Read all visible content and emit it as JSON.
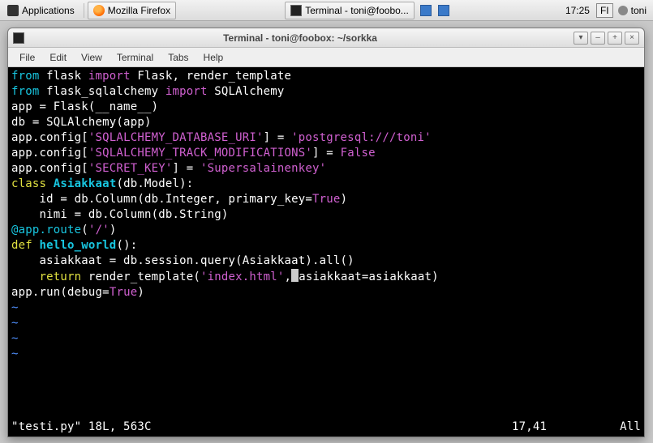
{
  "panel": {
    "applications": "Applications",
    "firefox": "Mozilla Firefox",
    "terminal_task": "Terminal - toni@foobo...",
    "clock": "17:25",
    "keyboard": "FI",
    "user": "toni"
  },
  "window": {
    "title": "Terminal - toni@foobox: ~/sorkka",
    "menu": {
      "file": "File",
      "edit": "Edit",
      "view": "View",
      "terminal": "Terminal",
      "tabs": "Tabs",
      "help": "Help"
    },
    "buttons": {
      "minus": "–",
      "plus": "+",
      "close": "×",
      "shade": "▾"
    }
  },
  "code": {
    "l1_a": "from",
    "l1_b": " flask ",
    "l1_c": "import",
    "l1_d": " Flask, render_template",
    "l2_a": "from",
    "l2_b": " flask_sqlalchemy ",
    "l2_c": "import",
    "l2_d": " SQLAlchemy",
    "l3": "app = Flask(__name__)",
    "l4": "",
    "l5": "db = SQLAlchemy(app)",
    "l6_a": "app.config[",
    "l6_b": "'SQLALCHEMY_DATABASE_URI'",
    "l6_c": "] = ",
    "l6_d": "'postgresql:///toni'",
    "l7_a": "app.config[",
    "l7_b": "'SQLALCHEMY_TRACK_MODIFICATIONS'",
    "l7_c": "] = ",
    "l7_d": "False",
    "l8_a": "app.config[",
    "l8_b": "'SECRET_KEY'",
    "l8_c": "] = ",
    "l8_d": "'Supersalainenkey'",
    "l9": "",
    "l10_a": "class",
    "l10_b": " Asiakkaat",
    "l10_c": "(db.Model):",
    "l11_a": "    id = db.Column(db.Integer, primary_key=",
    "l11_b": "True",
    "l11_c": ")",
    "l12": "    nimi = db.Column(db.String)",
    "l13": "",
    "l14_a": "@app.route",
    "l14_b": "(",
    "l14_c": "'/'",
    "l14_d": ")",
    "l15_a": "def",
    "l15_b": " hello_world",
    "l15_c": "():",
    "l16": "    asiakkaat = db.session.query(Asiakkaat).all()",
    "l17_a": "    ",
    "l17_b": "return",
    "l17_c": " render_template(",
    "l17_d": "'index.html'",
    "l17_e": ",",
    "l17_f": "asiakkaat=asiakkaat)",
    "l18_a": "app.run(debug=",
    "l18_b": "True",
    "l18_c": ")",
    "tilde": "~"
  },
  "status": {
    "left": "\"testi.py\" 18L, 563C",
    "pos": "17,41",
    "right": "All"
  }
}
